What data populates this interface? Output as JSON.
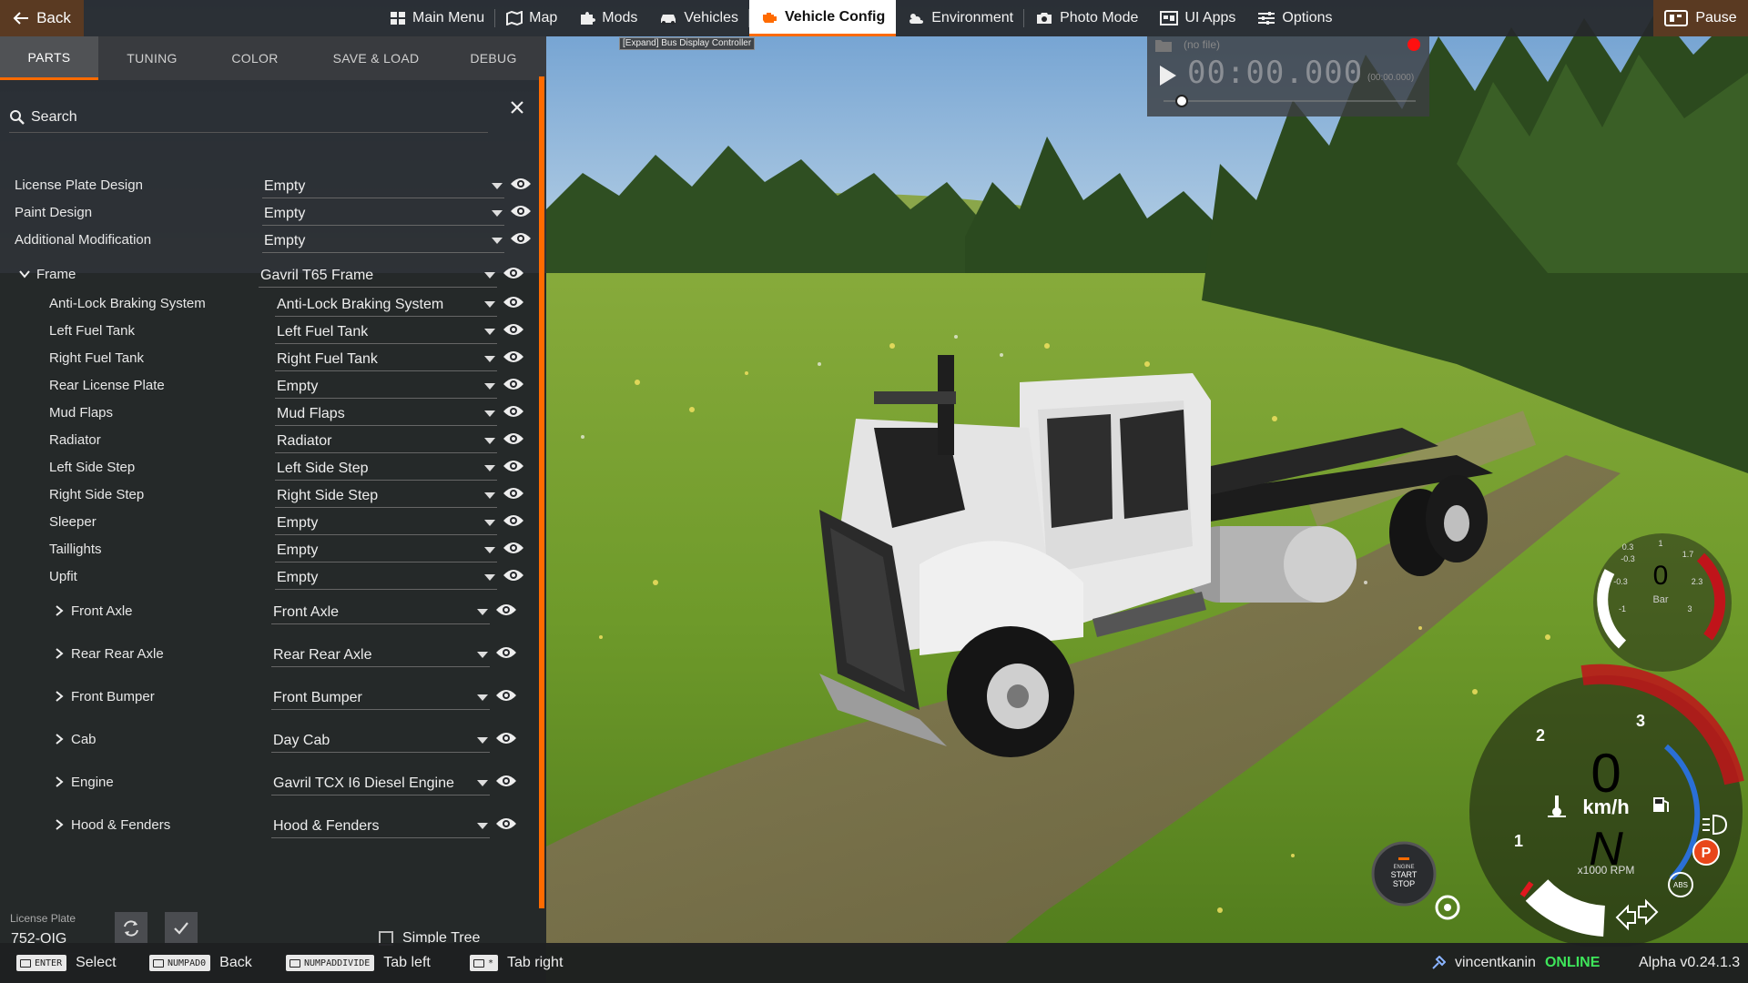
{
  "topbar": {
    "back_label": "Back",
    "menu": [
      {
        "label": "Main Menu",
        "icon": "grid-icon",
        "active": false
      },
      {
        "label": "Map",
        "icon": "map-icon",
        "active": false
      },
      {
        "label": "Mods",
        "icon": "puzzle-icon",
        "active": false
      },
      {
        "label": "Vehicles",
        "icon": "car-icon",
        "active": false
      },
      {
        "label": "Vehicle Config",
        "icon": "engine-icon",
        "active": true
      },
      {
        "label": "Environment",
        "icon": "weather-icon",
        "active": false
      },
      {
        "label": "Photo Mode",
        "icon": "camera-icon",
        "active": false
      },
      {
        "label": "UI Apps",
        "icon": "apps-icon",
        "active": false
      },
      {
        "label": "Options",
        "icon": "sliders-icon",
        "active": false
      }
    ],
    "pause_label": "Pause"
  },
  "tabs": [
    {
      "label": "PARTS",
      "active": true
    },
    {
      "label": "TUNING",
      "active": false
    },
    {
      "label": "COLOR",
      "active": false
    },
    {
      "label": "SAVE & LOAD",
      "active": false
    },
    {
      "label": "DEBUG",
      "active": false
    }
  ],
  "search": {
    "label": "Search"
  },
  "parts_top": [
    {
      "label": "License Plate Design",
      "value": "Empty"
    },
    {
      "label": "Paint Design",
      "value": "Empty"
    },
    {
      "label": "Additional Modification",
      "value": "Empty"
    }
  ],
  "frame": {
    "label": "Frame",
    "value": "Gavril T65 Frame",
    "expanded": true
  },
  "frame_children": [
    {
      "label": "Anti-Lock Braking System",
      "value": "Anti-Lock Braking System"
    },
    {
      "label": "Left Fuel Tank",
      "value": "Left Fuel Tank"
    },
    {
      "label": "Right Fuel Tank",
      "value": "Right Fuel Tank"
    },
    {
      "label": "Rear License Plate",
      "value": "Empty"
    },
    {
      "label": "Mud Flaps",
      "value": "Mud Flaps"
    },
    {
      "label": "Radiator",
      "value": "Radiator"
    },
    {
      "label": "Left Side Step",
      "value": "Left Side Step"
    },
    {
      "label": "Right Side Step",
      "value": "Right Side Step"
    },
    {
      "label": "Sleeper",
      "value": "Empty"
    },
    {
      "label": "Taillights",
      "value": "Empty"
    },
    {
      "label": "Upfit",
      "value": "Empty"
    }
  ],
  "frame_groups": [
    {
      "label": "Front Axle",
      "value": "Front Axle"
    },
    {
      "label": "Rear Rear Axle",
      "value": "Rear Rear Axle"
    },
    {
      "label": "Front Bumper",
      "value": "Front Bumper"
    },
    {
      "label": "Cab",
      "value": "Day Cab"
    },
    {
      "label": "Engine",
      "value": "Gavril TCX I6 Diesel Engine"
    },
    {
      "label": "Hood & Fenders",
      "value": "Hood & Fenders"
    }
  ],
  "license_plate": {
    "label": "License Plate",
    "value": "752-QIG"
  },
  "simple_tree": {
    "label": "Simple Tree",
    "checked": false
  },
  "tooltip": {
    "text": "[Expand] Bus Display Controller"
  },
  "replay": {
    "file": "(no file)",
    "time": "00:00.000",
    "sub": "(00:00.000)"
  },
  "hud": {
    "air_gauge": {
      "value": "0",
      "unit": "Bar",
      "ticks": [
        "-0.3",
        "0.3",
        "1",
        "1.7",
        "2.3",
        "3",
        "-1",
        "-0.3"
      ]
    },
    "speed": "0",
    "speed_unit": "km/h",
    "gear": "N",
    "rpm_unit": "x1000 RPM",
    "rpm_ticks": [
      "1",
      "2",
      "3"
    ],
    "parking_label": "P",
    "abs_label": "ABS",
    "engine_button": {
      "line1": "ENGINE",
      "line2": "START",
      "line3": "STOP"
    },
    "colors": {
      "redline": "#c0141a",
      "blue_arc": "#2a6fd6",
      "parking": "#e8461a"
    }
  },
  "bottom_hints": [
    {
      "key": "ENTER",
      "text": "Select"
    },
    {
      "key": "NUMPAD0",
      "text": "Back"
    },
    {
      "key": "NUMPADDIVIDE",
      "text": "Tab left"
    },
    {
      "key": "*",
      "text": "Tab right"
    }
  ],
  "user": {
    "name": "vincentkanin",
    "status": "ONLINE"
  },
  "version": "Alpha v0.24.1.3",
  "colors": {
    "accent": "#ff6b00",
    "online": "#3ee65a"
  }
}
